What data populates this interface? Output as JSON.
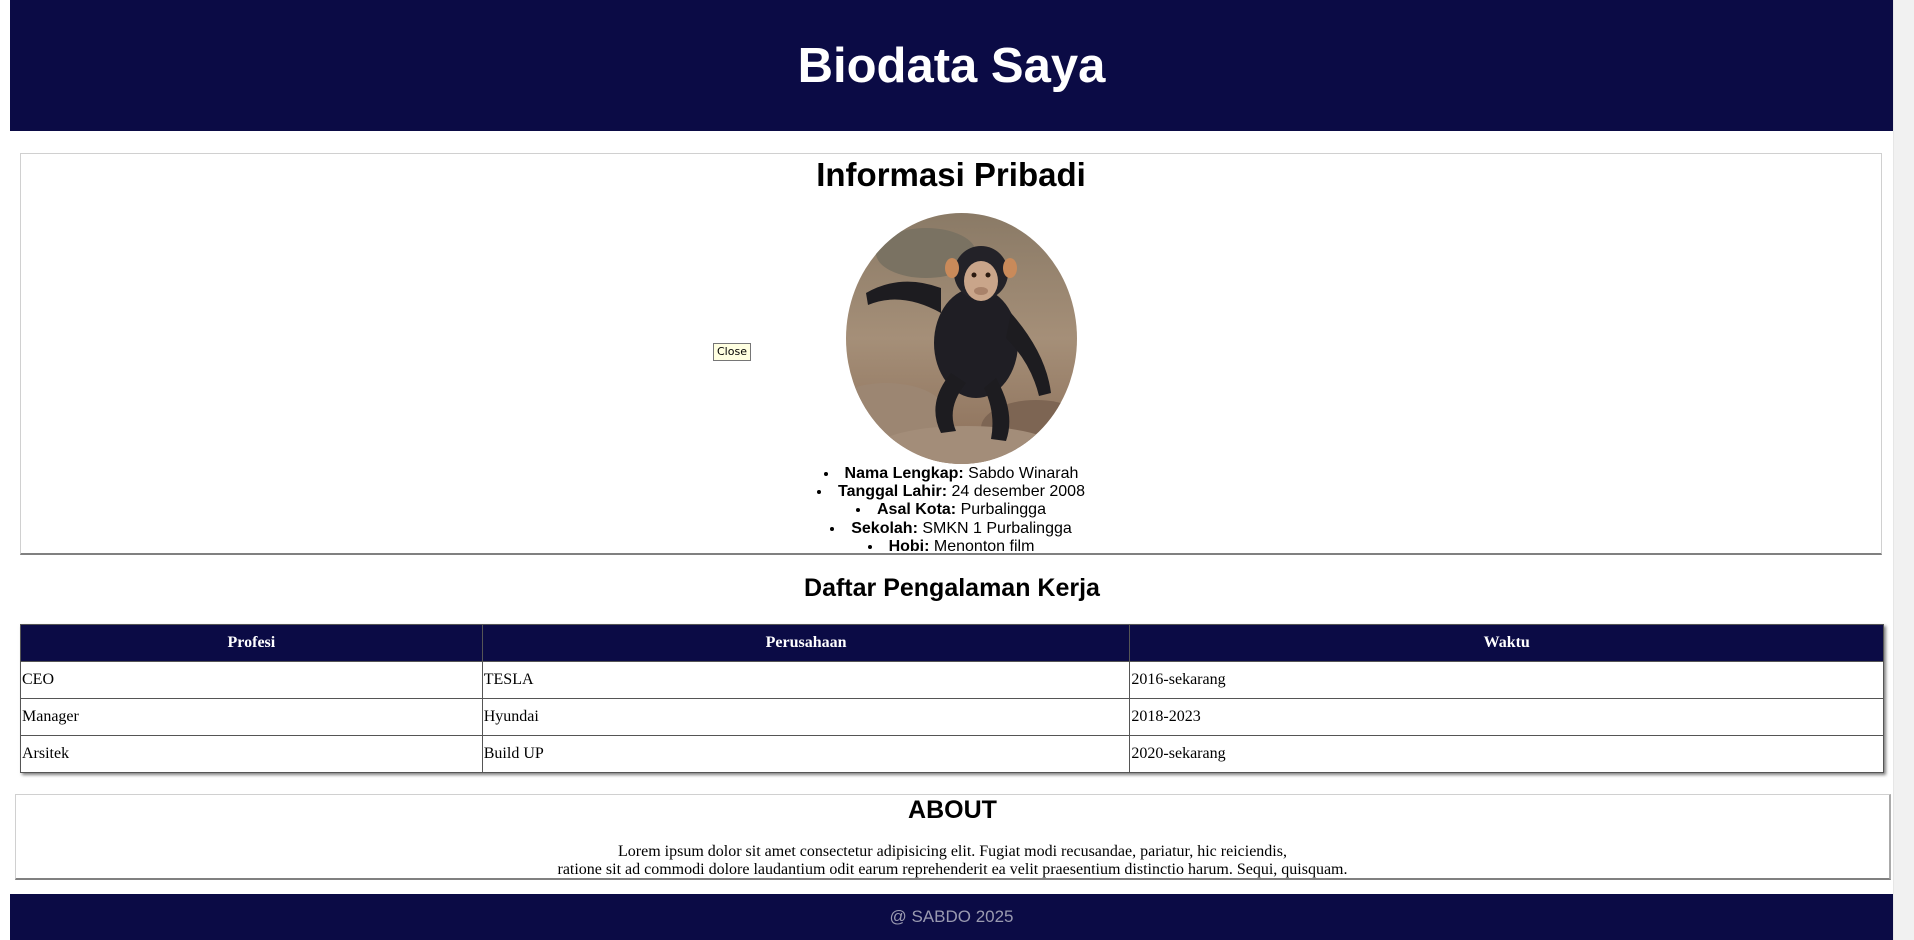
{
  "header": {
    "title": "Biodata Saya"
  },
  "info": {
    "heading": "Informasi Pribadi",
    "close_label": "Close",
    "items": [
      {
        "label": "Nama Lengkap:",
        "value": "Sabdo Winarah"
      },
      {
        "label": "Tanggal Lahir:",
        "value": "24 desember 2008"
      },
      {
        "label": "Asal Kota:",
        "value": "Purbalingga"
      },
      {
        "label": "Sekolah:",
        "value": "SMKN 1 Purbalingga"
      },
      {
        "label": "Hobi:",
        "value": "Menonton film"
      }
    ]
  },
  "kerja": {
    "heading": "Daftar Pengalaman Kerja",
    "columns": [
      "Profesi",
      "Perusahaan",
      "Waktu"
    ],
    "rows": [
      [
        "CEO",
        "TESLA",
        "2016-sekarang"
      ],
      [
        "Manager",
        "Hyundai",
        "2018-2023"
      ],
      [
        "Arsitek",
        "Build UP",
        "2020-sekarang"
      ]
    ]
  },
  "about": {
    "heading": "ABOUT",
    "line1": "Lorem ipsum dolor sit amet consectetur adipisicing elit. Fugiat modi recusandae, pariatur, hic reiciendis,",
    "line2": "ratione sit ad commodi dolore laudantium odit earum reprehenderit ea velit praesentium distinctio harum. Sequi, quisquam."
  },
  "footer": {
    "text": "@ SABDO 2025"
  },
  "colors": {
    "navy": "#0b0b45",
    "white": "#ffffff"
  }
}
